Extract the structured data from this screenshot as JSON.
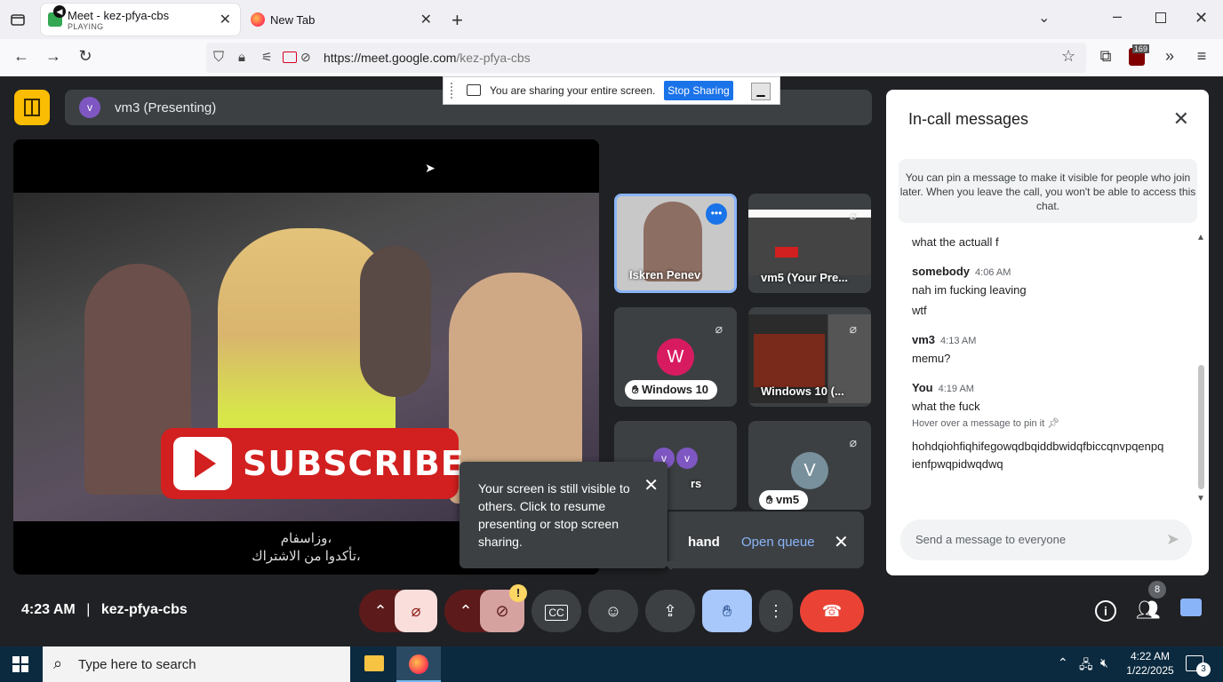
{
  "browser": {
    "tabs": [
      {
        "title": "Meet - kez-pfya-cbs",
        "subtitle": "PLAYING",
        "active": true
      },
      {
        "title": "New Tab",
        "active": false
      }
    ],
    "url_host": "https://meet.google.com",
    "url_path": "/kez-pfya-cbs"
  },
  "share_banner": {
    "text": "You are sharing your entire screen.",
    "stop_label": "Stop Sharing"
  },
  "presenting": {
    "avatar_letter": "v",
    "label": "vm3 (Presenting)"
  },
  "main_video": {
    "subscribe_text": "SUBSCRIBE",
    "caption_line1": "وزاسفام،",
    "caption_line2": "تأكدوا من الاشتراك،"
  },
  "tiles": [
    {
      "name": "Iskren Penev"
    },
    {
      "name": "vm5 (Your Pre..."
    },
    {
      "letter": "W",
      "name": "Windows 10"
    },
    {
      "name": "Windows 10 (..."
    },
    {
      "letters": [
        "v",
        "v"
      ],
      "name": "rs"
    },
    {
      "letter": "V",
      "name": "vm5"
    }
  ],
  "tooltip": {
    "text": "Your screen is still visible to others. Click to resume presenting or stop screen sharing."
  },
  "queue": {
    "hand_label": "hand",
    "open_queue_label": "Open queue"
  },
  "chat": {
    "title": "In-call messages",
    "pin_note": "You can pin a message to make it visible for people who join later. When you leave the call, you won't be able to access this chat.",
    "messages": [
      {
        "text": "what the actuall f"
      },
      {
        "sender": "somebody",
        "time": "4:06 AM",
        "lines": [
          "nah im fucking leaving",
          "wtf"
        ]
      },
      {
        "sender": "vm3",
        "time": "4:13 AM",
        "lines": [
          "memu?"
        ]
      },
      {
        "sender": "You",
        "time": "4:19 AM",
        "lines": [
          "what the fuck"
        ],
        "hint": "Hover over a message to pin it"
      },
      {
        "text": "hohdqiohfiqhifegowqdbqiddbwidqfbiccqnvpqenpqienfpwqpidwqdwq"
      }
    ],
    "input_placeholder": "Send a message to everyone"
  },
  "controls": {
    "time": "4:23 AM",
    "meeting_code": "kez-pfya-cbs",
    "people_count": "8",
    "warning_badge": "!"
  },
  "taskbar": {
    "search_placeholder": "Type here to search",
    "clock_time": "4:22 AM",
    "clock_date": "1/22/2025",
    "notification_count": "3"
  },
  "extension_badge": "169"
}
